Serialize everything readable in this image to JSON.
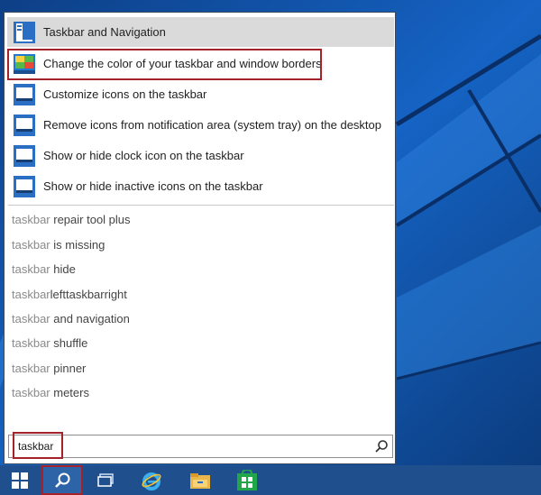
{
  "results": [
    {
      "label": "Taskbar and Navigation",
      "icon": "taskbar-navigation-icon"
    },
    {
      "label": "Change the color of your taskbar and window borders",
      "icon": "color-settings-icon"
    },
    {
      "label": "Customize icons on the taskbar",
      "icon": "taskbar-settings-icon"
    },
    {
      "label": "Remove icons from notification area (system tray) on the desktop",
      "icon": "taskbar-settings-icon"
    },
    {
      "label": "Show or hide clock icon on the taskbar",
      "icon": "taskbar-settings-icon"
    },
    {
      "label": "Show or hide inactive icons on the taskbar",
      "icon": "taskbar-settings-icon"
    }
  ],
  "suggestions": [
    {
      "prefix": "taskbar",
      "rest": " repair tool plus"
    },
    {
      "prefix": "taskbar",
      "rest": " is missing"
    },
    {
      "prefix": "taskbar",
      "rest": " hide"
    },
    {
      "prefix": "taskbar",
      "rest": "lefttaskbarright"
    },
    {
      "prefix": "taskbar",
      "rest": " and navigation"
    },
    {
      "prefix": "taskbar",
      "rest": " shuffle"
    },
    {
      "prefix": "taskbar",
      "rest": " pinner"
    },
    {
      "prefix": "taskbar",
      "rest": " meters"
    }
  ],
  "search": {
    "value": "taskbar",
    "button_icon": "search-icon"
  },
  "taskbar": {
    "items": [
      "start-icon",
      "search-icon",
      "task-view-icon",
      "internet-explorer-icon",
      "file-explorer-icon",
      "store-icon"
    ]
  },
  "colors": {
    "desktop": "#1a5fb4",
    "taskbar": "#1f4f8c",
    "highlight_border": "#a4232a",
    "selected_row": "#dadada"
  }
}
